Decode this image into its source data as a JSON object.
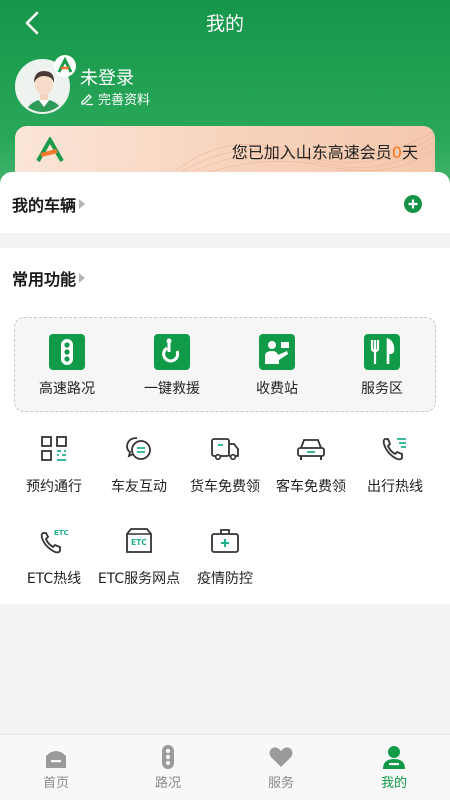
{
  "header": {
    "title": "我的",
    "user": {
      "name": "未登录",
      "edit_label": "完善资料"
    },
    "member_card": {
      "prefix": "您已加入山东高速会员",
      "days": "0",
      "suffix": "天"
    }
  },
  "vehicles": {
    "title": "我的车辆"
  },
  "functions": {
    "title": "常用功能",
    "featured": [
      {
        "label": "高速路况",
        "icon": "traffic-light-icon"
      },
      {
        "label": "一键救援",
        "icon": "rescue-hook-icon"
      },
      {
        "label": "收费站",
        "icon": "toll-booth-icon"
      },
      {
        "label": "服务区",
        "icon": "fork-knife-icon"
      }
    ],
    "services": [
      {
        "label": "预约通行",
        "icon": "qr-code-icon"
      },
      {
        "label": "车友互动",
        "icon": "chat-bubbles-icon"
      },
      {
        "label": "货车免费领",
        "icon": "truck-icon"
      },
      {
        "label": "客车免费领",
        "icon": "car-icon"
      },
      {
        "label": "出行热线",
        "icon": "phone-list-icon"
      },
      {
        "label": "ETC热线",
        "icon": "phone-etc-icon"
      },
      {
        "label": "ETC服务网点",
        "icon": "etc-station-icon"
      },
      {
        "label": "疫情防控",
        "icon": "medical-kit-icon"
      }
    ]
  },
  "tabbar": {
    "tabs": [
      {
        "label": "首页",
        "icon": "home-icon",
        "active": false
      },
      {
        "label": "路况",
        "icon": "traffic-light-icon",
        "active": false
      },
      {
        "label": "服务",
        "icon": "heart-icon",
        "active": false
      },
      {
        "label": "我的",
        "icon": "user-icon",
        "active": true
      }
    ]
  },
  "colors": {
    "brand_green": "#119a47",
    "accent_orange": "#f07a2a",
    "tab_inactive": "#8a8a8a"
  }
}
